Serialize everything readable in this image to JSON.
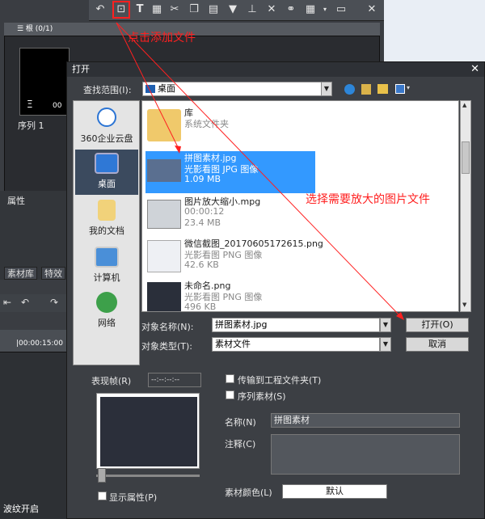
{
  "app": {
    "bin_header": "☰ 根 (0/1)",
    "sequence_label": "序列 1",
    "properties_label": "属性",
    "tabs": [
      "素材库",
      "特效"
    ],
    "timecode": "|00:00:15:00",
    "status_text": "波纹开启",
    "thumb_time": "00"
  },
  "toolbar": {
    "icons": [
      "undo-arrow-icon",
      "add-file-icon",
      "title-icon",
      "palette-icon",
      "cut-icon",
      "copy-icon",
      "paste-icon",
      "marker-icon",
      "insert-icon",
      "delete-icon",
      "mix-icon",
      "grid-icon",
      "dropdown-icon",
      "folder-icon",
      "close-icon"
    ],
    "close": "✕"
  },
  "annotations": {
    "add_file": "点击添加文件",
    "select_image": "选择需要放大的图片文件",
    "color": "#ff2020"
  },
  "dialog": {
    "title": "打开",
    "close": "✕",
    "lookin_label": "查找范围(I):",
    "lookin_value": "桌面",
    "places": [
      {
        "label": "360企业云盘",
        "icon": "cloud-icon"
      },
      {
        "label": "桌面",
        "icon": "desktop-icon"
      },
      {
        "label": "我的文档",
        "icon": "documents-icon"
      },
      {
        "label": "计算机",
        "icon": "computer-icon"
      },
      {
        "label": "网络",
        "icon": "network-icon"
      }
    ],
    "files": [
      {
        "name": "库",
        "meta1": "系统文件夹",
        "meta2": "",
        "icon": "library-folder-icon"
      },
      {
        "name": "拼图素材.jpg",
        "meta1": "光影看图 JPG 图像",
        "meta2": "1.09 MB",
        "icon": "image-thumbnail-icon",
        "selected": true
      },
      {
        "name": "图片放大缩小.mpg",
        "meta1": "00:00:12",
        "meta2": "23.4 MB",
        "icon": "video-file-icon"
      },
      {
        "name": "微信截图_20170605172615.png",
        "meta1": "光影看图 PNG 图像",
        "meta2": "42.6 KB",
        "icon": "screenshot-thumbnail-icon"
      },
      {
        "name": "未命名.png",
        "meta1": "光影看图 PNG 图像",
        "meta2": "496 KB",
        "icon": "photo-thumbnail-icon"
      }
    ],
    "filename_label": "对象名称(N):",
    "filename_value": "拼图素材.jpg",
    "filetype_label": "对象类型(T):",
    "filetype_value": "素材文件",
    "open_button": "打开(O)",
    "cancel_button": "取消",
    "frame_label": "表现帧(R)",
    "frame_value": "--:--:--:--",
    "transfer_label": "传输到工程文件夹(T)",
    "sequence_label": "序列素材(S)",
    "name_label": "名称(N)",
    "name_value": "拼图素材",
    "comment_label": "注释(C)",
    "show_props_label": "显示属性(P)",
    "clip_color_label": "素材颜色(L)",
    "clip_color_value": "默认"
  }
}
